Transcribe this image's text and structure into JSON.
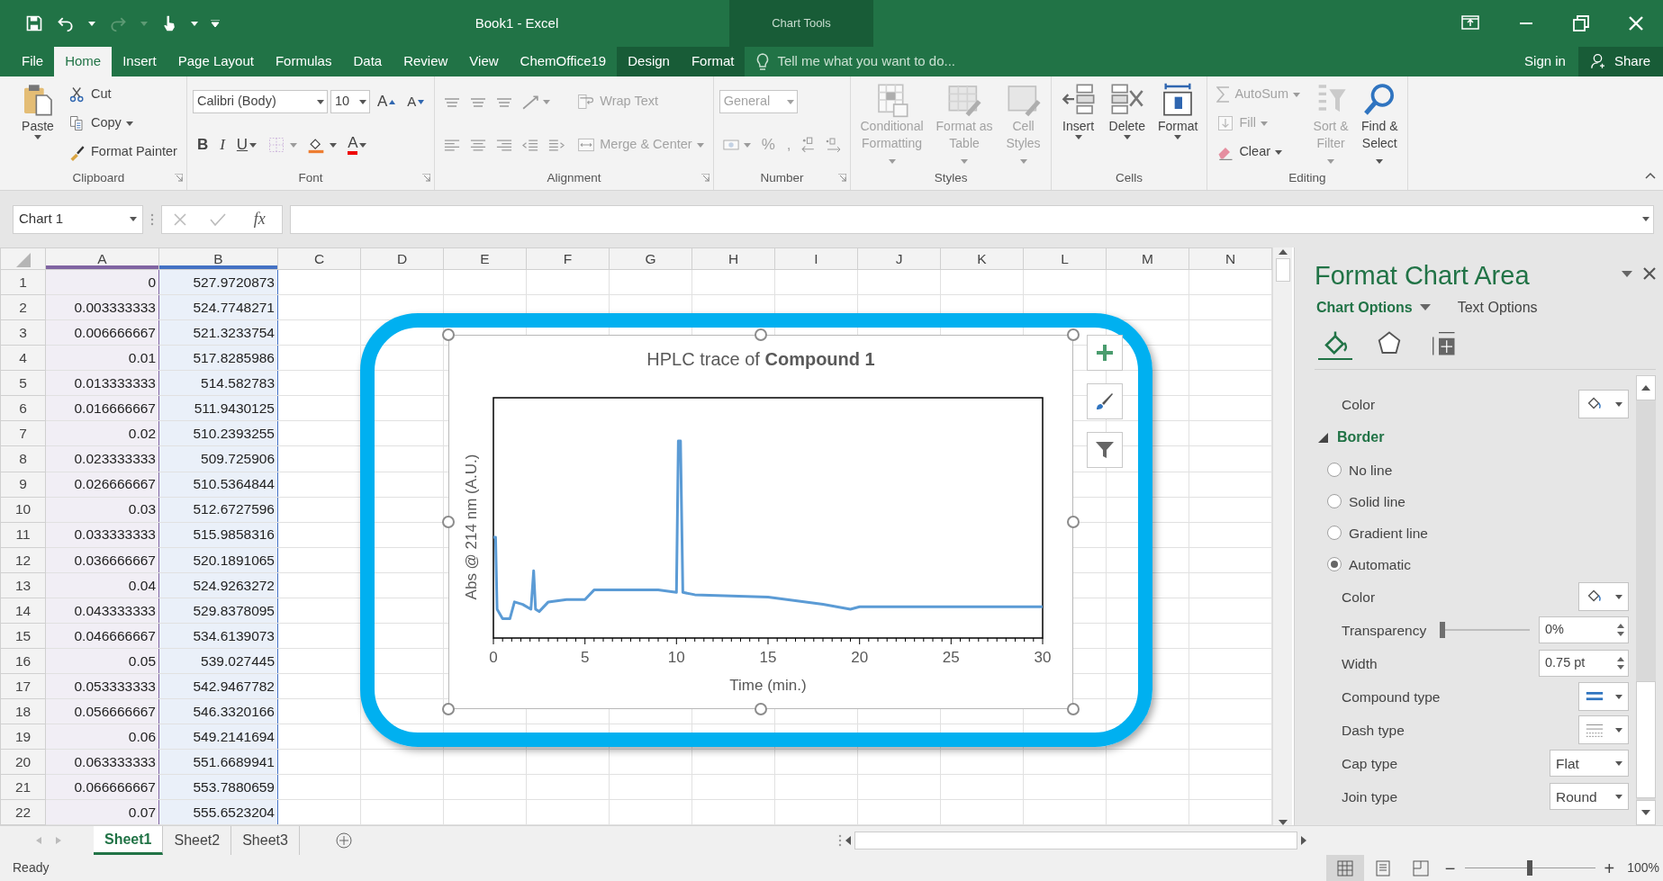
{
  "title_bar": {
    "title": "Book1 - Excel",
    "context_label": "Chart Tools"
  },
  "tabs": [
    {
      "label": "File",
      "selected": false,
      "contextual": false
    },
    {
      "label": "Home",
      "selected": true,
      "contextual": false
    },
    {
      "label": "Insert",
      "selected": false,
      "contextual": false
    },
    {
      "label": "Page Layout",
      "selected": false,
      "contextual": false
    },
    {
      "label": "Formulas",
      "selected": false,
      "contextual": false
    },
    {
      "label": "Data",
      "selected": false,
      "contextual": false
    },
    {
      "label": "Review",
      "selected": false,
      "contextual": false
    },
    {
      "label": "View",
      "selected": false,
      "contextual": false
    },
    {
      "label": "ChemOffice19",
      "selected": false,
      "contextual": false
    },
    {
      "label": "Design",
      "selected": false,
      "contextual": true
    },
    {
      "label": "Format",
      "selected": false,
      "contextual": true
    }
  ],
  "tell_me": {
    "placeholder": "Tell me what you want to do..."
  },
  "account": {
    "sign_in": "Sign in",
    "share": "Share"
  },
  "ribbon": {
    "groups": [
      {
        "label": "Clipboard",
        "launcher": true,
        "blocks": [
          {
            "kind": "large",
            "label_lines": [
              "Paste"
            ],
            "dropdown": true,
            "disabled": false
          },
          {
            "kind": "stack",
            "rows": [
              {
                "items": [
                  {
                    "kind": "button",
                    "label": "Cut",
                    "dropdown": false,
                    "disabled": false
                  }
                ]
              },
              {
                "items": [
                  {
                    "kind": "button",
                    "label": "Copy",
                    "dropdown": true,
                    "disabled": false
                  }
                ]
              },
              {
                "items": [
                  {
                    "kind": "button",
                    "label": "Format Painter",
                    "dropdown": false,
                    "disabled": false
                  }
                ]
              }
            ]
          }
        ]
      },
      {
        "label": "Font",
        "launcher": true,
        "blocks": [
          {
            "kind": "stack",
            "rows": [
              {
                "items": [
                  {
                    "kind": "field",
                    "value": "Calibri (Body)",
                    "disabled": false
                  },
                  {
                    "kind": "field",
                    "value": "10",
                    "disabled": false
                  },
                  {
                    "kind": "grow",
                    "label": "A",
                    "disabled": false
                  },
                  {
                    "kind": "shrink",
                    "label": "A",
                    "disabled": false
                  }
                ]
              },
              {
                "items": [
                  {
                    "kind": "bold",
                    "label": "B",
                    "dropdown": false,
                    "disabled": false
                  },
                  {
                    "kind": "italic",
                    "label": "I",
                    "dropdown": false,
                    "disabled": false
                  },
                  {
                    "kind": "underline",
                    "label": "U",
                    "dropdown": true,
                    "disabled": false
                  },
                  {
                    "kind": "icon",
                    "dropdown": true,
                    "disabled": true
                  },
                  {
                    "kind": "icon",
                    "dropdown": true,
                    "disabled": false
                  },
                  {
                    "kind": "font_color",
                    "label": "A",
                    "dropdown": true,
                    "disabled": false
                  }
                ]
              }
            ]
          }
        ]
      },
      {
        "label": "Alignment",
        "launcher": true,
        "blocks": [
          {
            "kind": "stack",
            "rows": [
              {
                "items": [
                  {
                    "kind": "icon",
                    "dropdown": false,
                    "disabled": true
                  },
                  {
                    "kind": "icon",
                    "dropdown": false,
                    "disabled": true
                  },
                  {
                    "kind": "icon",
                    "dropdown": false,
                    "disabled": true
                  },
                  {
                    "kind": "icon",
                    "dropdown": true,
                    "disabled": true
                  }
                ]
              },
              {
                "items": [
                  {
                    "kind": "icon",
                    "dropdown": false,
                    "disabled": true
                  },
                  {
                    "kind": "icon",
                    "dropdown": false,
                    "disabled": true
                  },
                  {
                    "kind": "icon",
                    "dropdown": false,
                    "disabled": true
                  },
                  {
                    "kind": "icon",
                    "dropdown": false,
                    "disabled": true
                  },
                  {
                    "kind": "icon",
                    "dropdown": false,
                    "disabled": true
                  }
                ]
              }
            ]
          },
          {
            "kind": "stack",
            "rows": [
              {
                "items": [
                  {
                    "kind": "button",
                    "label": "Wrap Text",
                    "dropdown": false,
                    "disabled": true
                  }
                ]
              },
              {
                "items": [
                  {
                    "kind": "button",
                    "label": "Merge & Center",
                    "dropdown": true,
                    "disabled": true
                  }
                ]
              }
            ]
          }
        ]
      },
      {
        "label": "Number",
        "launcher": true,
        "blocks": [
          {
            "kind": "stack",
            "rows": [
              {
                "items": [
                  {
                    "kind": "field",
                    "value": "General",
                    "disabled": true
                  }
                ]
              },
              {
                "items": [
                  {
                    "kind": "icon",
                    "dropdown": true,
                    "disabled": true
                  },
                  {
                    "kind": "glyph",
                    "label": "%",
                    "disabled": true
                  },
                  {
                    "kind": "glyph",
                    "label": ",",
                    "disabled": true
                  },
                  {
                    "kind": "icon",
                    "dropdown": false,
                    "disabled": true
                  },
                  {
                    "kind": "icon",
                    "dropdown": false,
                    "disabled": true
                  }
                ]
              }
            ]
          }
        ]
      },
      {
        "label": "Styles",
        "launcher": false,
        "blocks": [
          {
            "kind": "large",
            "label_lines": [
              "Conditional",
              "Formatting"
            ],
            "dropdown": true,
            "disabled": true
          },
          {
            "kind": "large",
            "label_lines": [
              "Format as",
              "Table"
            ],
            "dropdown": true,
            "disabled": true
          },
          {
            "kind": "large",
            "label_lines": [
              "Cell",
              "Styles"
            ],
            "dropdown": true,
            "disabled": true
          }
        ]
      },
      {
        "label": "Cells",
        "launcher": false,
        "blocks": [
          {
            "kind": "large",
            "label_lines": [
              "Insert"
            ],
            "dropdown": true,
            "disabled": false
          },
          {
            "kind": "large",
            "label_lines": [
              "Delete"
            ],
            "dropdown": true,
            "disabled": false
          },
          {
            "kind": "large",
            "label_lines": [
              "Format"
            ],
            "dropdown": true,
            "disabled": false
          }
        ]
      },
      {
        "label": "Editing",
        "launcher": false,
        "blocks": [
          {
            "kind": "stack",
            "rows": [
              {
                "items": [
                  {
                    "kind": "button",
                    "label": "AutoSum",
                    "dropdown": true,
                    "disabled": true
                  }
                ]
              },
              {
                "items": [
                  {
                    "kind": "button",
                    "label": "Fill",
                    "dropdown": true,
                    "disabled": true
                  }
                ]
              },
              {
                "items": [
                  {
                    "kind": "button",
                    "label": "Clear",
                    "dropdown": true,
                    "disabled": false
                  }
                ]
              }
            ]
          },
          {
            "kind": "large",
            "label_lines": [
              "Sort &",
              "Filter"
            ],
            "dropdown": true,
            "disabled": true
          },
          {
            "kind": "large",
            "label_lines": [
              "Find &",
              "Select"
            ],
            "dropdown": true,
            "disabled": false
          }
        ]
      }
    ]
  },
  "formula_bar": {
    "name_box": "Chart 1",
    "function_label": "fx"
  },
  "sheet": {
    "columns": [
      {
        "label": "A",
        "color": "#8064a2"
      },
      {
        "label": "B",
        "color": "#4472c4"
      },
      {
        "label": "C"
      },
      {
        "label": "D"
      },
      {
        "label": "E"
      },
      {
        "label": "F"
      },
      {
        "label": "G"
      },
      {
        "label": "H"
      },
      {
        "label": "I"
      },
      {
        "label": "J"
      },
      {
        "label": "K"
      },
      {
        "label": "L"
      },
      {
        "label": "M"
      },
      {
        "label": "N"
      }
    ],
    "rows": [
      {
        "number": "1",
        "cells": [
          "0",
          "527.9720873"
        ]
      },
      {
        "number": "2",
        "cells": [
          "0.003333333",
          "524.7748271"
        ]
      },
      {
        "number": "3",
        "cells": [
          "0.006666667",
          "521.3233754"
        ]
      },
      {
        "number": "4",
        "cells": [
          "0.01",
          "517.8285986"
        ]
      },
      {
        "number": "5",
        "cells": [
          "0.013333333",
          "514.582783"
        ]
      },
      {
        "number": "6",
        "cells": [
          "0.016666667",
          "511.9430125"
        ]
      },
      {
        "number": "7",
        "cells": [
          "0.02",
          "510.2393255"
        ]
      },
      {
        "number": "8",
        "cells": [
          "0.023333333",
          "509.725906"
        ]
      },
      {
        "number": "9",
        "cells": [
          "0.026666667",
          "510.5364844"
        ]
      },
      {
        "number": "10",
        "cells": [
          "0.03",
          "512.6727596"
        ]
      },
      {
        "number": "11",
        "cells": [
          "0.033333333",
          "515.9858316"
        ]
      },
      {
        "number": "12",
        "cells": [
          "0.036666667",
          "520.1891065"
        ]
      },
      {
        "number": "13",
        "cells": [
          "0.04",
          "524.9263272"
        ]
      },
      {
        "number": "14",
        "cells": [
          "0.043333333",
          "529.8378095"
        ]
      },
      {
        "number": "15",
        "cells": [
          "0.046666667",
          "534.6139073"
        ]
      },
      {
        "number": "16",
        "cells": [
          "0.05",
          "539.027445"
        ]
      },
      {
        "number": "17",
        "cells": [
          "0.053333333",
          "542.9467782"
        ]
      },
      {
        "number": "18",
        "cells": [
          "0.056666667",
          "546.3320166"
        ]
      },
      {
        "number": "19",
        "cells": [
          "0.06",
          "549.2141694"
        ]
      },
      {
        "number": "20",
        "cells": [
          "0.063333333",
          "551.6689941"
        ]
      },
      {
        "number": "21",
        "cells": [
          "0.066666667",
          "553.7880659"
        ]
      },
      {
        "number": "22",
        "cells": [
          "0.07",
          "555.6523204"
        ]
      }
    ]
  },
  "chart": {
    "title": "HPLC trace of **Compound 1**",
    "ylabel": "Abs @ 214 nm (A.U.)",
    "xlabel": "Time (min.)",
    "x_tick_labels": [
      "0",
      "5",
      "10",
      "15",
      "20",
      "25",
      "30"
    ]
  },
  "panel": {
    "title": "Format Chart Area",
    "tabs": [
      {
        "label": "Chart Options",
        "selected": true,
        "dropdown": true
      },
      {
        "label": "Text Options",
        "selected": false,
        "dropdown": false
      }
    ],
    "icon_tabs": [
      {
        "selected": true
      },
      {
        "selected": false
      },
      {
        "selected": false
      }
    ],
    "rows": [
      {
        "kind": "color",
        "label": "Color"
      },
      {
        "kind": "section",
        "label": "Border",
        "expanded": true
      },
      {
        "kind": "radio",
        "label": "No line",
        "selected": false
      },
      {
        "kind": "radio",
        "label": "Solid line",
        "selected": false
      },
      {
        "kind": "radio",
        "label": "Gradient line",
        "selected": false
      },
      {
        "kind": "radio",
        "label": "Automatic",
        "selected": true
      },
      {
        "kind": "color",
        "label": "Color"
      },
      {
        "kind": "slider",
        "label": "Transparency",
        "level": 0,
        "value": "0%"
      },
      {
        "kind": "spin",
        "label": "Width",
        "value": "0.75 pt"
      },
      {
        "kind": "compound",
        "label": "Compound type"
      },
      {
        "kind": "dash",
        "label": "Dash type"
      },
      {
        "kind": "dropdown",
        "label": "Cap type",
        "value": "Flat"
      },
      {
        "kind": "dropdown",
        "label": "Join type",
        "value": "Round"
      }
    ]
  },
  "sheet_tabs": [
    {
      "label": "Sheet1",
      "selected": true
    },
    {
      "label": "Sheet2",
      "selected": false
    },
    {
      "label": "Sheet3",
      "selected": false
    }
  ],
  "status_bar": {
    "text": "Ready",
    "views": [
      {
        "selected": true
      },
      {
        "selected": false
      },
      {
        "selected": false
      }
    ],
    "zoom_out": "−",
    "zoom": {
      "level": 0.5
    },
    "zoom_in": "+",
    "zoom_text": "100%"
  }
}
